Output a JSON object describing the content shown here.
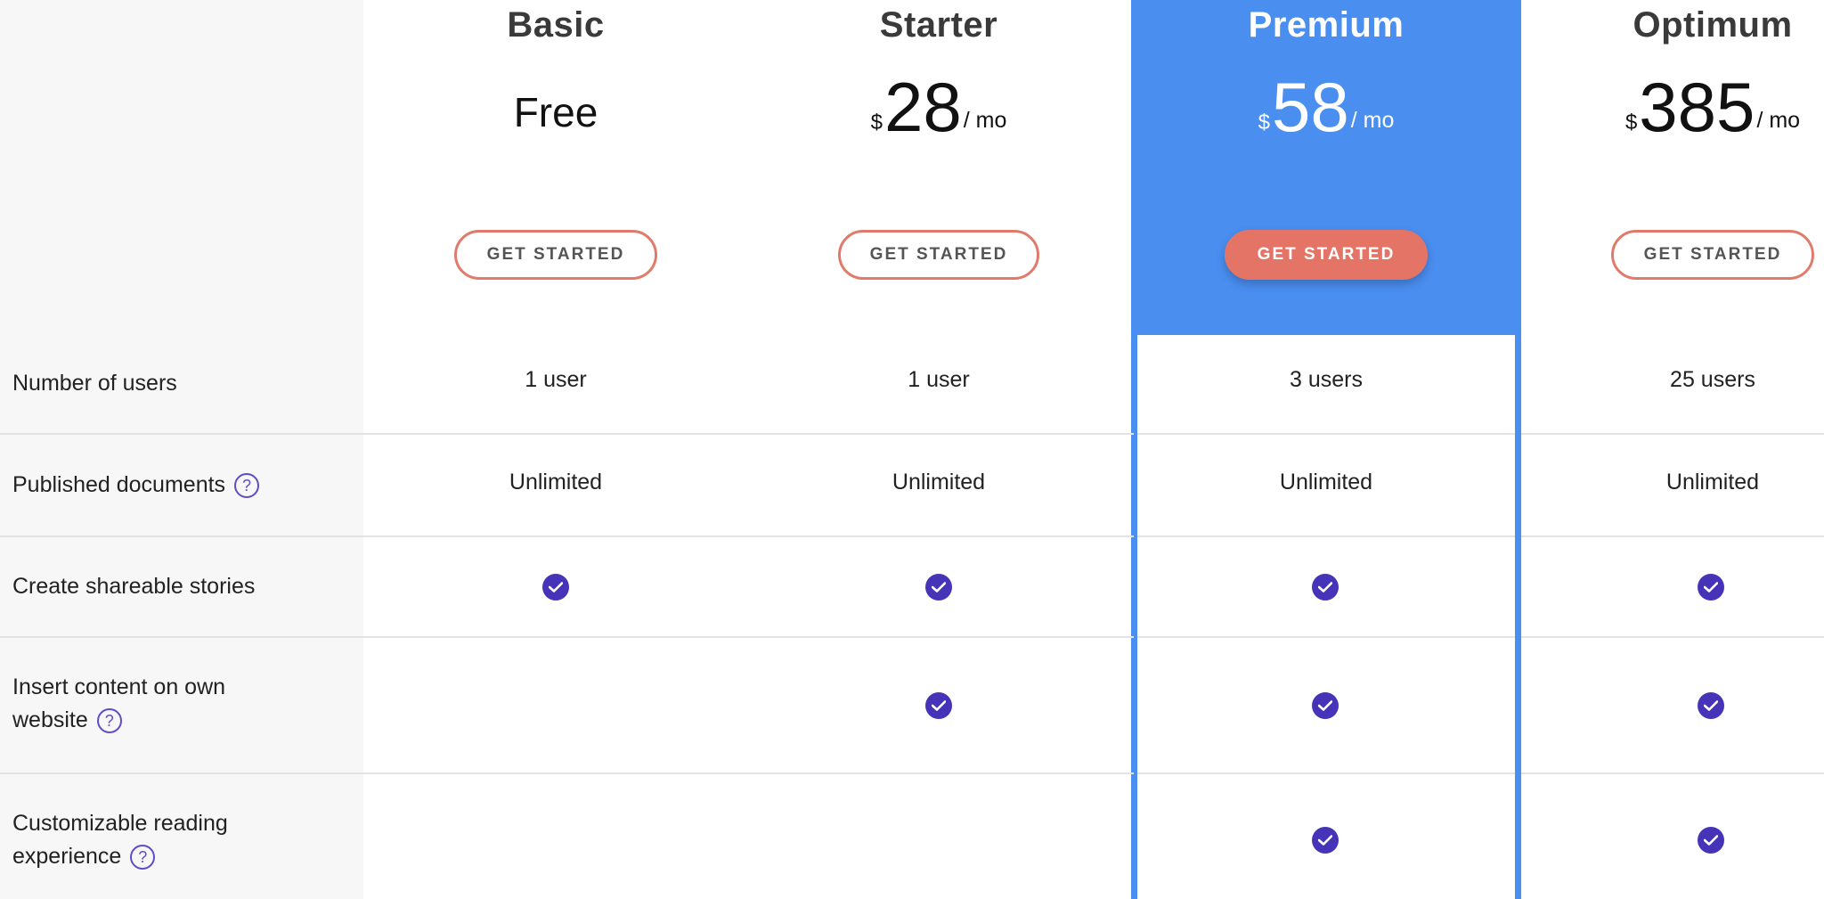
{
  "plans": [
    {
      "name": "Basic",
      "price_free": "Free",
      "cta": "GET STARTED"
    },
    {
      "name": "Starter",
      "currency": "$",
      "amount": "28",
      "period": "/ mo",
      "cta": "GET STARTED"
    },
    {
      "name": "Premium",
      "currency": "$",
      "amount": "58",
      "period": "/ mo",
      "cta": "GET STARTED"
    },
    {
      "name": "Optimum",
      "currency": "$",
      "amount": "385",
      "period": "/ mo",
      "cta": "GET STARTED"
    }
  ],
  "features": [
    {
      "label": "Number of users",
      "values": [
        "1 user",
        "1 user",
        "3 users",
        "25 users"
      ]
    },
    {
      "label": "Published documents",
      "help": "?",
      "values": [
        "Unlimited",
        "Unlimited",
        "Unlimited",
        "Unlimited"
      ]
    },
    {
      "label": "Create shareable stories",
      "checks": [
        true,
        true,
        true,
        true
      ]
    },
    {
      "label_line1": "Insert content on own",
      "label_line2": "website",
      "help": "?",
      "checks": [
        false,
        true,
        true,
        true
      ]
    },
    {
      "label_line1": "Customizable reading",
      "label_line2": "experience",
      "help": "?",
      "checks": [
        false,
        false,
        true,
        true
      ]
    }
  ],
  "colors": {
    "featured": "#4a8ef0",
    "cta": "#e47566",
    "check": "#4634b8",
    "help": "#5f4cc7"
  },
  "icons": {
    "help": "question-circle-icon",
    "check": "check-circle-icon"
  }
}
